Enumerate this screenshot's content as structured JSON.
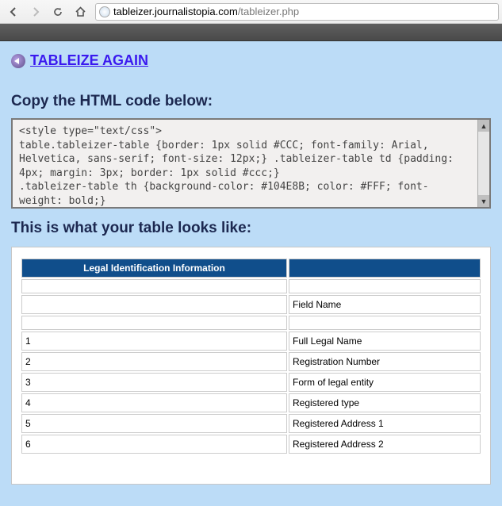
{
  "browser": {
    "url_dark": "tableizer.journalistopia.com",
    "url_gray": "/tableizer.php"
  },
  "page": {
    "again_link": "TABLEIZE AGAIN",
    "copy_heading": "Copy the HTML code below:",
    "preview_heading": "This is what your table looks like:",
    "code_text": "<style type=\"text/css\">\ntable.tableizer-table {border: 1px solid #CCC; font-family: Arial, Helvetica, sans-serif; font-size: 12px;} .tableizer-table td {padding: 4px; margin: 3px; border: 1px solid #ccc;}\n.tableizer-table th {background-color: #104E8B; color: #FFF; font-weight: bold;}\n</style>"
  },
  "table": {
    "header_a": "Legal Identification Information",
    "header_b": "",
    "rows": [
      {
        "a": "",
        "b": ""
      },
      {
        "a": "",
        "b": "Field Name"
      },
      {
        "a": "",
        "b": ""
      },
      {
        "a": "1",
        "b": "Full Legal Name"
      },
      {
        "a": "2",
        "b": "Registration Number"
      },
      {
        "a": "3",
        "b": "Form of legal entity"
      },
      {
        "a": "4",
        "b": "Registered type"
      },
      {
        "a": "5",
        "b": "Registered Address 1"
      },
      {
        "a": "6",
        "b": "Registered Address 2"
      }
    ]
  }
}
